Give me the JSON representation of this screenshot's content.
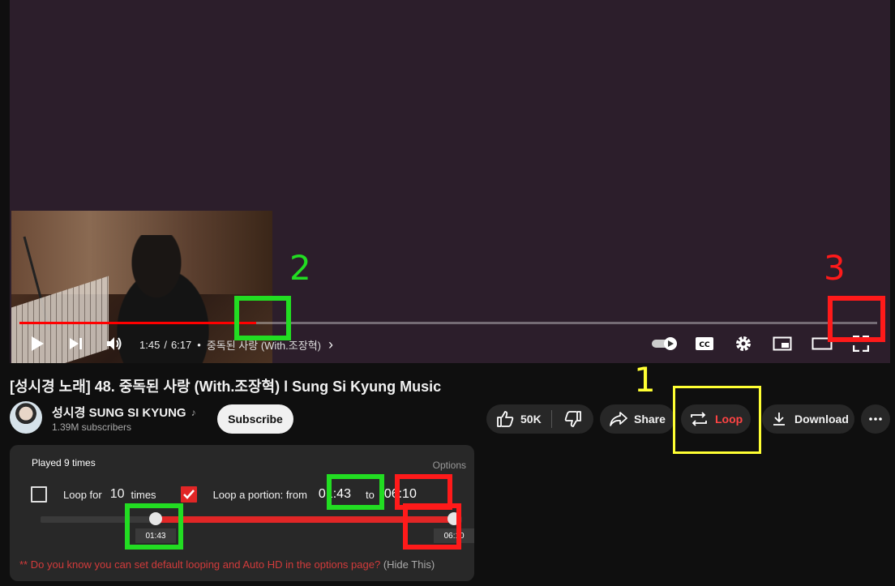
{
  "player": {
    "time_current": "1:45",
    "time_total": "6:17",
    "time_sep": "/",
    "chapter_dot": "•",
    "chapter": "중독된 사랑 (With.조장혁)",
    "progress_fraction": 0.276
  },
  "video": {
    "title": "[성시경 노래] 48. 중독된 사랑 (With.조장혁) l Sung Si Kyung Music"
  },
  "channel": {
    "name": "성시경 SUNG SI KYUNG",
    "subscribers": "1.39M subscribers",
    "subscribe_label": "Subscribe"
  },
  "actions": {
    "like_count": "50K",
    "share_label": "Share",
    "loop_label": "Loop",
    "download_label": "Download"
  },
  "loop_panel": {
    "played_text": "Played 9 times",
    "options_label": "Options",
    "loop_for_label": "Loop for",
    "loop_times_value": "10",
    "times_label": "times",
    "loop_portion_label": "Loop a portion: from",
    "from_time": "01:43",
    "to_label": "to",
    "to_time": "06:10",
    "slider_start_label": "01:43",
    "slider_end_label": "06:10",
    "slider_start_fraction": 0.273,
    "slider_end_fraction": 0.981,
    "tip_text": "** Do you know you can set default looping and Auto HD in the options page?",
    "hide_label": "(Hide This)"
  },
  "annotations": {
    "label_1": "1",
    "label_2": "2",
    "label_3": "3",
    "color_yellow": "#ffff33",
    "color_green": "#22dd22",
    "color_red": "#ff1a1a"
  }
}
